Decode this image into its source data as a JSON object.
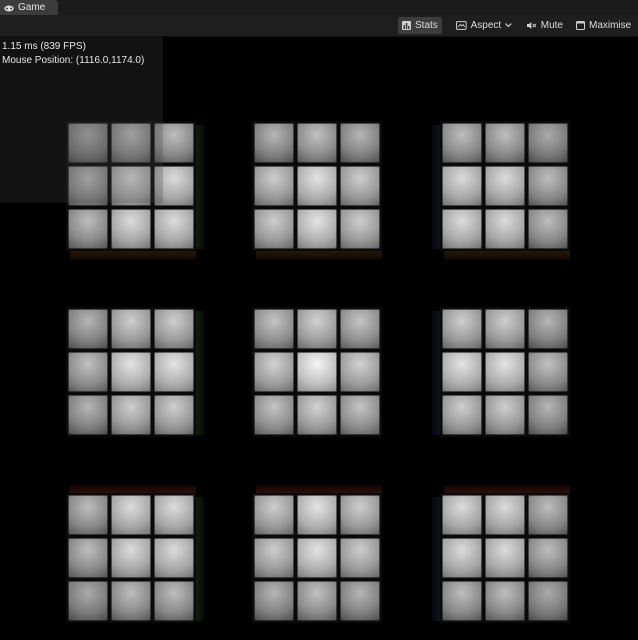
{
  "tab": {
    "label": "Game",
    "icon": "gamepad-icon"
  },
  "toolbar": {
    "stats_label": "Stats",
    "aspect_label": "Aspect",
    "mute_label": "Mute",
    "maximise_label": "Maximise"
  },
  "stats": {
    "frame_time": "1.15 ms (839 FPS)",
    "mouse_position": "Mouse Position: (1116.0,1174.0)"
  },
  "scene": {
    "cube_count": 9,
    "grid": "3x3",
    "sticker_grid": "3x3",
    "face_color": "#e0e0e0",
    "background_color": "#000000"
  },
  "colors": {
    "tab_bg": "#3c3c3c",
    "toolbar_bg": "#1e1e1e",
    "active_button_bg": "#3d3d3d",
    "text": "#dcdcdc"
  }
}
